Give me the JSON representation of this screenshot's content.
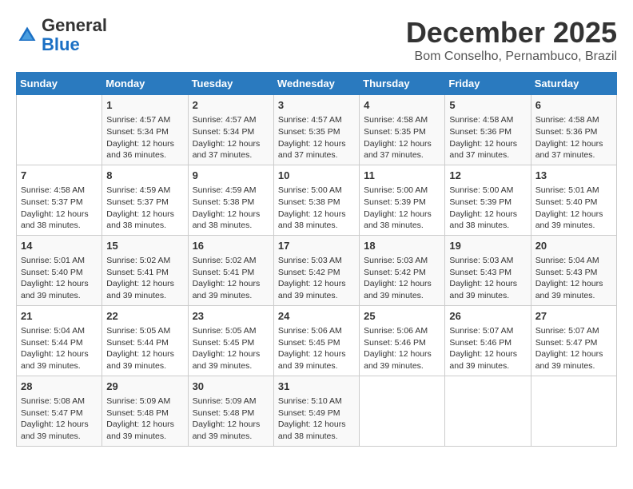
{
  "header": {
    "logo_general": "General",
    "logo_blue": "Blue",
    "month": "December 2025",
    "location": "Bom Conselho, Pernambuco, Brazil"
  },
  "days_of_week": [
    "Sunday",
    "Monday",
    "Tuesday",
    "Wednesday",
    "Thursday",
    "Friday",
    "Saturday"
  ],
  "weeks": [
    [
      {
        "day": "",
        "content": ""
      },
      {
        "day": "1",
        "content": "Sunrise: 4:57 AM\nSunset: 5:34 PM\nDaylight: 12 hours\nand 36 minutes."
      },
      {
        "day": "2",
        "content": "Sunrise: 4:57 AM\nSunset: 5:34 PM\nDaylight: 12 hours\nand 37 minutes."
      },
      {
        "day": "3",
        "content": "Sunrise: 4:57 AM\nSunset: 5:35 PM\nDaylight: 12 hours\nand 37 minutes."
      },
      {
        "day": "4",
        "content": "Sunrise: 4:58 AM\nSunset: 5:35 PM\nDaylight: 12 hours\nand 37 minutes."
      },
      {
        "day": "5",
        "content": "Sunrise: 4:58 AM\nSunset: 5:36 PM\nDaylight: 12 hours\nand 37 minutes."
      },
      {
        "day": "6",
        "content": "Sunrise: 4:58 AM\nSunset: 5:36 PM\nDaylight: 12 hours\nand 37 minutes."
      }
    ],
    [
      {
        "day": "7",
        "content": "Sunrise: 4:58 AM\nSunset: 5:37 PM\nDaylight: 12 hours\nand 38 minutes."
      },
      {
        "day": "8",
        "content": "Sunrise: 4:59 AM\nSunset: 5:37 PM\nDaylight: 12 hours\nand 38 minutes."
      },
      {
        "day": "9",
        "content": "Sunrise: 4:59 AM\nSunset: 5:38 PM\nDaylight: 12 hours\nand 38 minutes."
      },
      {
        "day": "10",
        "content": "Sunrise: 5:00 AM\nSunset: 5:38 PM\nDaylight: 12 hours\nand 38 minutes."
      },
      {
        "day": "11",
        "content": "Sunrise: 5:00 AM\nSunset: 5:39 PM\nDaylight: 12 hours\nand 38 minutes."
      },
      {
        "day": "12",
        "content": "Sunrise: 5:00 AM\nSunset: 5:39 PM\nDaylight: 12 hours\nand 38 minutes."
      },
      {
        "day": "13",
        "content": "Sunrise: 5:01 AM\nSunset: 5:40 PM\nDaylight: 12 hours\nand 39 minutes."
      }
    ],
    [
      {
        "day": "14",
        "content": "Sunrise: 5:01 AM\nSunset: 5:40 PM\nDaylight: 12 hours\nand 39 minutes."
      },
      {
        "day": "15",
        "content": "Sunrise: 5:02 AM\nSunset: 5:41 PM\nDaylight: 12 hours\nand 39 minutes."
      },
      {
        "day": "16",
        "content": "Sunrise: 5:02 AM\nSunset: 5:41 PM\nDaylight: 12 hours\nand 39 minutes."
      },
      {
        "day": "17",
        "content": "Sunrise: 5:03 AM\nSunset: 5:42 PM\nDaylight: 12 hours\nand 39 minutes."
      },
      {
        "day": "18",
        "content": "Sunrise: 5:03 AM\nSunset: 5:42 PM\nDaylight: 12 hours\nand 39 minutes."
      },
      {
        "day": "19",
        "content": "Sunrise: 5:03 AM\nSunset: 5:43 PM\nDaylight: 12 hours\nand 39 minutes."
      },
      {
        "day": "20",
        "content": "Sunrise: 5:04 AM\nSunset: 5:43 PM\nDaylight: 12 hours\nand 39 minutes."
      }
    ],
    [
      {
        "day": "21",
        "content": "Sunrise: 5:04 AM\nSunset: 5:44 PM\nDaylight: 12 hours\nand 39 minutes."
      },
      {
        "day": "22",
        "content": "Sunrise: 5:05 AM\nSunset: 5:44 PM\nDaylight: 12 hours\nand 39 minutes."
      },
      {
        "day": "23",
        "content": "Sunrise: 5:05 AM\nSunset: 5:45 PM\nDaylight: 12 hours\nand 39 minutes."
      },
      {
        "day": "24",
        "content": "Sunrise: 5:06 AM\nSunset: 5:45 PM\nDaylight: 12 hours\nand 39 minutes."
      },
      {
        "day": "25",
        "content": "Sunrise: 5:06 AM\nSunset: 5:46 PM\nDaylight: 12 hours\nand 39 minutes."
      },
      {
        "day": "26",
        "content": "Sunrise: 5:07 AM\nSunset: 5:46 PM\nDaylight: 12 hours\nand 39 minutes."
      },
      {
        "day": "27",
        "content": "Sunrise: 5:07 AM\nSunset: 5:47 PM\nDaylight: 12 hours\nand 39 minutes."
      }
    ],
    [
      {
        "day": "28",
        "content": "Sunrise: 5:08 AM\nSunset: 5:47 PM\nDaylight: 12 hours\nand 39 minutes."
      },
      {
        "day": "29",
        "content": "Sunrise: 5:09 AM\nSunset: 5:48 PM\nDaylight: 12 hours\nand 39 minutes."
      },
      {
        "day": "30",
        "content": "Sunrise: 5:09 AM\nSunset: 5:48 PM\nDaylight: 12 hours\nand 39 minutes."
      },
      {
        "day": "31",
        "content": "Sunrise: 5:10 AM\nSunset: 5:49 PM\nDaylight: 12 hours\nand 38 minutes."
      },
      {
        "day": "",
        "content": ""
      },
      {
        "day": "",
        "content": ""
      },
      {
        "day": "",
        "content": ""
      }
    ]
  ]
}
